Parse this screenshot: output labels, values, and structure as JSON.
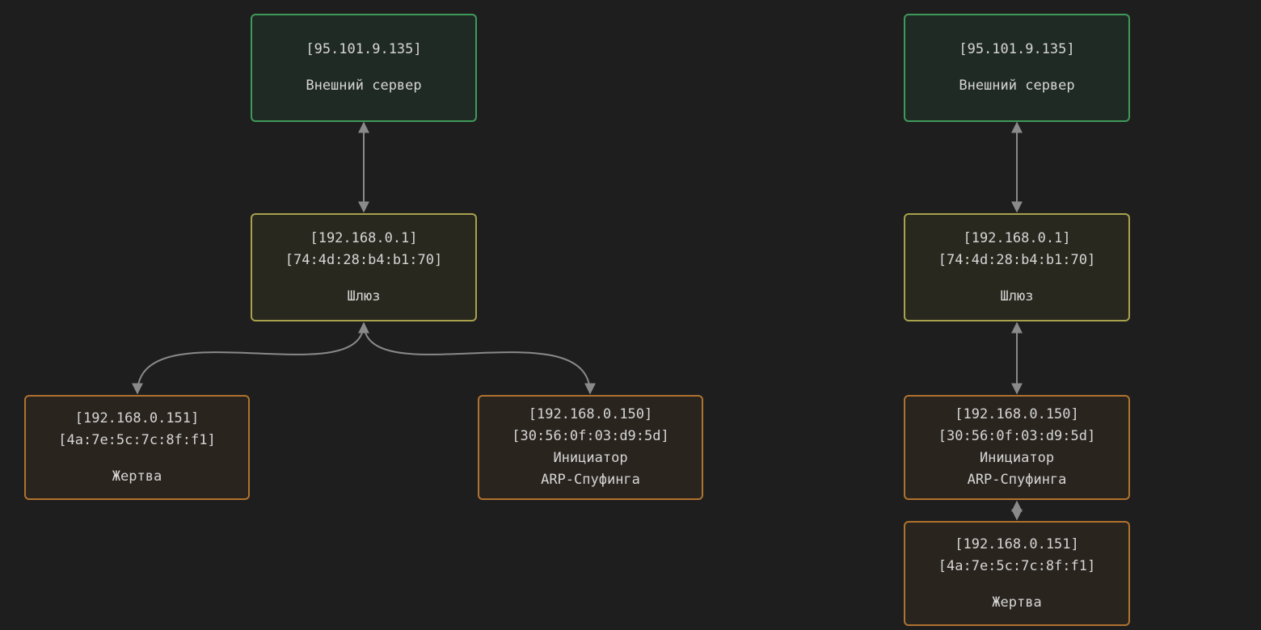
{
  "colors": {
    "background": "#1e1e1e",
    "server_border": "#3e9a5a",
    "gateway_border": "#a8a24c",
    "host_border": "#b0722f",
    "edge": "#8a8a8a"
  },
  "diagram_left": {
    "server": {
      "ip": "[95.101.9.135]",
      "label": "Внешний сервер"
    },
    "gateway": {
      "ip": "[192.168.0.1]",
      "mac": "[74:4d:28:b4:b1:70]",
      "label": "Шлюз"
    },
    "victim": {
      "ip": "[192.168.0.151]",
      "mac": "[4a:7e:5c:7c:8f:f1]",
      "label": "Жертва"
    },
    "initiator": {
      "ip": "[192.168.0.150]",
      "mac": "[30:56:0f:03:d9:5d]",
      "label_line1": "Инициатор",
      "label_line2": "ARP-Спуфинга"
    }
  },
  "diagram_right": {
    "server": {
      "ip": "[95.101.9.135]",
      "label": "Внешний сервер"
    },
    "gateway": {
      "ip": "[192.168.0.1]",
      "mac": "[74:4d:28:b4:b1:70]",
      "label": "Шлюз"
    },
    "initiator": {
      "ip": "[192.168.0.150]",
      "mac": "[30:56:0f:03:d9:5d]",
      "label_line1": "Инициатор",
      "label_line2": "ARP-Спуфинга"
    },
    "victim": {
      "ip": "[192.168.0.151]",
      "mac": "[4a:7e:5c:7c:8f:f1]",
      "label": "Жертва"
    }
  }
}
